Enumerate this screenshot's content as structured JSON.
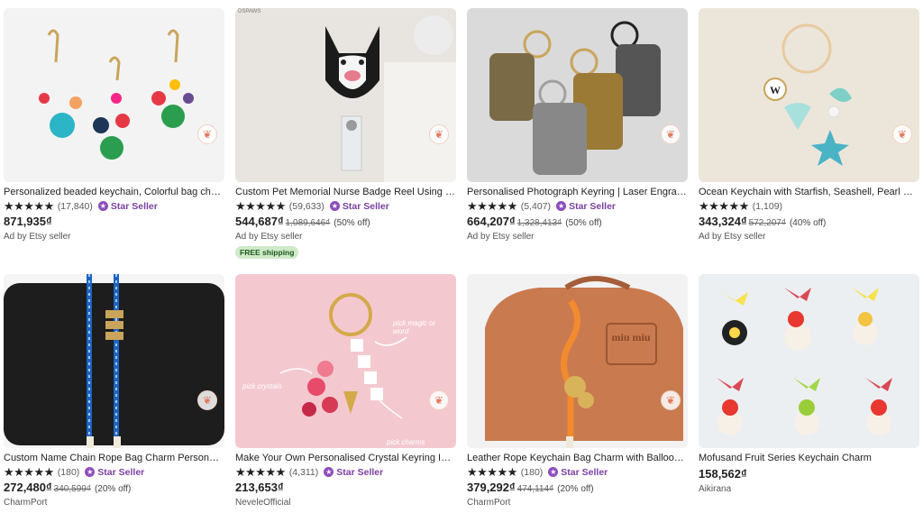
{
  "listings": [
    {
      "title": "Personalized beaded keychain, Colorful bag charm",
      "stars": "★★★★★",
      "count": "(17,840)",
      "star_seller": "Star Seller",
      "price": "871,935₫",
      "orig": "",
      "off": "",
      "seller": "Ad by Etsy seller",
      "ship": ""
    },
    {
      "title": "Custom Pet Memorial Nurse Badge Reel Using Photo",
      "stars": "★★★★★",
      "count": "(59,633)",
      "star_seller": "Star Seller",
      "price": "544,687₫",
      "orig": "1,089,646₫",
      "off": "(50% off)",
      "seller": "Ad by Etsy seller",
      "ship": "FREE shipping",
      "watermark": "DSPAWS"
    },
    {
      "title": "Personalised Photograph Keyring | Laser Engraved",
      "stars": "★★★★★",
      "count": "(5,407)",
      "star_seller": "Star Seller",
      "price": "664,207₫",
      "orig": "1,328,413₫",
      "off": "(50% off)",
      "seller": "Ad by Etsy seller",
      "ship": ""
    },
    {
      "title": "Ocean Keychain with Starfish, Seashell, Pearl Charms",
      "stars": "★★★★★",
      "count": "(1,109)",
      "star_seller": "",
      "price": "343,324₫",
      "orig": "572,207₫",
      "off": "(40% off)",
      "seller": "Ad by Etsy seller",
      "ship": ""
    },
    {
      "title": "Custom Name Chain Rope Bag Charm Personalized",
      "stars": "★★★★★",
      "count": "(180)",
      "star_seller": "Star Seller",
      "price": "272,480₫",
      "orig": "340,599₫",
      "off": "(20% off)",
      "seller": "CharmPort",
      "ship": ""
    },
    {
      "title": "Make Your Own Personalised Crystal Keyring Initial",
      "stars": "★★★★★",
      "count": "(4,311)",
      "star_seller": "Star Seller",
      "price": "213,653₫",
      "orig": "",
      "off": "",
      "seller": "NeveleOfficial",
      "ship": "",
      "annotations": [
        "pick crystals",
        "pick magic or word",
        "pick charms"
      ]
    },
    {
      "title": "Leather Rope Keychain Bag Charm with Balloon Dog",
      "stars": "★★★★★",
      "count": "(180)",
      "star_seller": "Star Seller",
      "price": "379,292₫",
      "orig": "474,114₫",
      "off": "(20% off)",
      "seller": "CharmPort",
      "ship": "",
      "bag_brand": "miu miu"
    },
    {
      "title": "Mofusand Fruit Series Keychain Charm",
      "stars": "",
      "count": "",
      "star_seller": "",
      "price": "158,562₫",
      "orig": "",
      "off": "",
      "seller": "Aikirana",
      "ship": ""
    }
  ],
  "colors": {
    "star_seller": "#7b3fa0",
    "free_ship_bg": "#cfe9c9"
  }
}
